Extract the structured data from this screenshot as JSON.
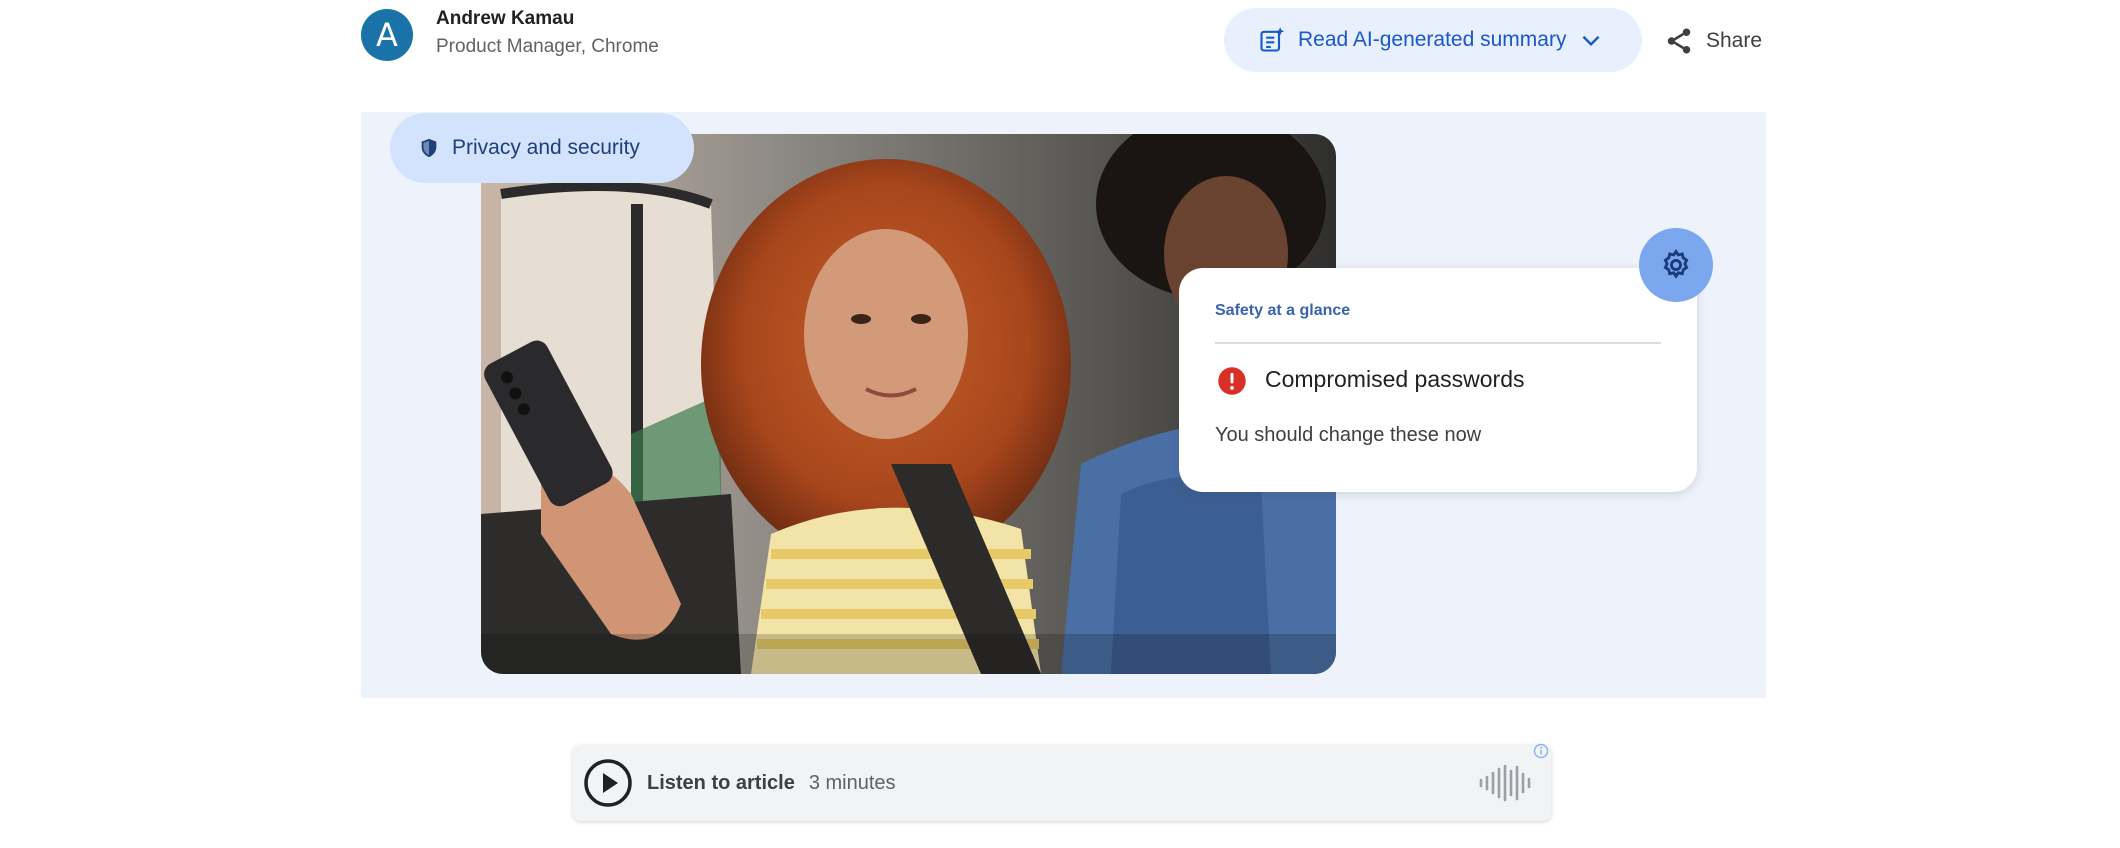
{
  "author": {
    "initial": "A",
    "name": "Andrew Kamau",
    "role": "Product Manager, Chrome"
  },
  "header": {
    "summary_label": "Read AI-generated summary",
    "share_label": "Share"
  },
  "hero": {
    "category_chip": "Privacy and security",
    "card": {
      "title": "Safety at a glance",
      "heading": "Compromised passwords",
      "subtext": "You should change these now"
    }
  },
  "listen": {
    "label": "Listen to article",
    "duration": "3 minutes"
  },
  "colors": {
    "accent_blue": "#1a57c7",
    "chip_bg": "#d3e3fd",
    "hero_bg": "#eef3fb",
    "warning_red": "#d93025",
    "gear_bg": "#7ba7ee"
  },
  "icons": [
    "doc-sparkle-icon",
    "chevron-down-icon",
    "share-icon",
    "shield-icon",
    "gear-icon",
    "warning-icon",
    "play-icon",
    "waveform-icon",
    "info-icon"
  ]
}
